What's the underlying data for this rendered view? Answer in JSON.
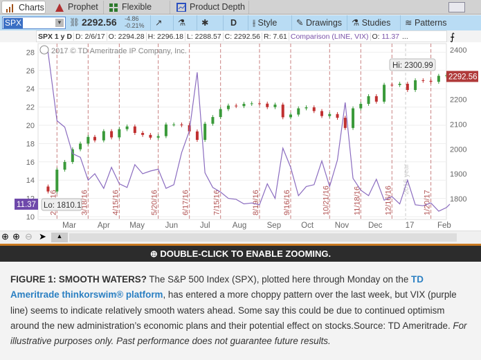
{
  "tabs": [
    {
      "label": "Charts",
      "icon": "bar-chart-icon",
      "active": true
    },
    {
      "label": "Prophet",
      "icon": "prophet-icon"
    },
    {
      "label": "Flexible Grid",
      "icon": "grid-icon"
    },
    {
      "label": "Product Depth",
      "icon": "depth-icon"
    }
  ],
  "toolbar": {
    "symbol": "SPX",
    "price": "2292.56",
    "change": "-4.86",
    "change_pct": "-0.21%",
    "aggregation": "D",
    "style": "Style",
    "drawings": "Drawings",
    "studies": "Studies",
    "patterns": "Patterns"
  },
  "info": {
    "title": "SPX 1 y D",
    "date": "D: 2/6/17",
    "open": "O: 2294.28",
    "high": "H: 2296.18",
    "low": "L: 2288.57",
    "close": "C: 2292.56",
    "range": "R: 7.61",
    "comparison": "Comparison (LINE, VIX)",
    "comp_open_label": "O: ",
    "comp_open": "11.37",
    "more": "..."
  },
  "chart_data": {
    "type": "candlestick+line",
    "copyright": "2017 © TD Ameritrade IP Company, Inc.",
    "left_axis": {
      "range": [
        10,
        28
      ],
      "ticks": [
        10,
        12,
        14,
        16,
        18,
        20,
        22,
        24,
        26,
        28
      ]
    },
    "right_axis": {
      "range": [
        1700,
        2400
      ],
      "ticks": [
        "1800",
        "1900",
        "2000",
        "2100",
        "2200",
        "2300",
        "2400"
      ]
    },
    "x_ticks": [
      "Mar",
      "Apr",
      "May",
      "Jun",
      "Jul",
      "Aug",
      "Sep",
      "Oct",
      "Nov",
      "Dec",
      "17",
      "Feb"
    ],
    "event_markers": [
      "2/19/16",
      "3/18/16",
      "4/15/16",
      "5/20/16",
      "6/17/16",
      "7/15/16",
      "8/19/16",
      "9/16/16",
      "10/21/16",
      "11/18/16",
      "12/16/16",
      "1/20/17"
    ],
    "year_marker": "2016 year",
    "hi_label": "Hi: 2300.99",
    "lo_label": "Lo: 1810.1",
    "last_spx": "2292.56",
    "last_vix": "11.37",
    "colors": {
      "spx_up": "#3a9a3a",
      "spx_down": "#c03030",
      "vix": "#8a6bbf",
      "marker": "#c98080"
    },
    "dates": [
      "2016-02-11",
      "2016-02-19",
      "2016-02-26",
      "2016-03-04",
      "2016-03-11",
      "2016-03-18",
      "2016-03-24",
      "2016-04-01",
      "2016-04-08",
      "2016-04-15",
      "2016-04-22",
      "2016-04-29",
      "2016-05-06",
      "2016-05-13",
      "2016-05-20",
      "2016-05-27",
      "2016-06-03",
      "2016-06-10",
      "2016-06-17",
      "2016-06-24",
      "2016-07-01",
      "2016-07-08",
      "2016-07-15",
      "2016-07-22",
      "2016-07-29",
      "2016-08-05",
      "2016-08-12",
      "2016-08-19",
      "2016-08-26",
      "2016-09-02",
      "2016-09-09",
      "2016-09-16",
      "2016-09-23",
      "2016-09-30",
      "2016-10-07",
      "2016-10-14",
      "2016-10-21",
      "2016-10-28",
      "2016-11-04",
      "2016-11-11",
      "2016-11-18",
      "2016-11-25",
      "2016-12-02",
      "2016-12-09",
      "2016-12-16",
      "2016-12-23",
      "2016-12-30",
      "2017-01-06",
      "2017-01-13",
      "2017-01-20",
      "2017-01-27",
      "2017-02-03",
      "2017-02-06"
    ],
    "series": [
      {
        "name": "SPX",
        "axis": "right",
        "values": [
          1829,
          1917,
          1948,
          1999,
          2022,
          2049,
          2035,
          2072,
          2047,
          2080,
          2091,
          2065,
          2057,
          2046,
          2052,
          2099,
          2099,
          2096,
          2071,
          2037,
          2102,
          2129,
          2161,
          2175,
          2173,
          2182,
          2184,
          2183,
          2169,
          2179,
          2128,
          2139,
          2164,
          2168,
          2153,
          2133,
          2141,
          2126,
          2085,
          2164,
          2182,
          2213,
          2191,
          2259,
          2258,
          2263,
          2238,
          2277,
          2275,
          2271,
          2295,
          2297,
          2292.56
        ]
      },
      {
        "name": "VIX",
        "axis": "left",
        "values": [
          28,
          20.5,
          19.8,
          16.9,
          16.5,
          14,
          14.7,
          13.1,
          15.4,
          13.6,
          13.2,
          15.7,
          14.7,
          15,
          15.2,
          13.1,
          13.5,
          17,
          19.4,
          25.8,
          14.8,
          13.2,
          12.7,
          12,
          11.9,
          11.4,
          11.5,
          11.3,
          13.6,
          12,
          17.5,
          15.4,
          12.3,
          13.3,
          13.5,
          16.1,
          13.3,
          16.2,
          22.5,
          14.2,
          12.9,
          12.3,
          14.1,
          11.8,
          12.2,
          11.4,
          14,
          11.3,
          11.2,
          11.5,
          10.6,
          11,
          11.37
        ]
      }
    ]
  },
  "banner": "DOUBLE-CLICK TO ENABLE ZOOMING.",
  "caption": {
    "heading": "FIGURE 1: SMOOTH WATERS?",
    "p1": " The S&P 500 Index (SPX), plotted here through Monday on the ",
    "link": "TD Ameritrade thinkorswim® platform",
    "p2": ", has entered a more choppy pattern over the last week, but VIX (purple line) seems to indicate relatively smooth waters ahead. Some say this could be due to continued optimism around the new administration’s economic plans and their potential effect on stocks.Source: TD Ameritrade. ",
    "disclaimer": "For illustrative purposes only. Past performance does not guarantee future results."
  }
}
